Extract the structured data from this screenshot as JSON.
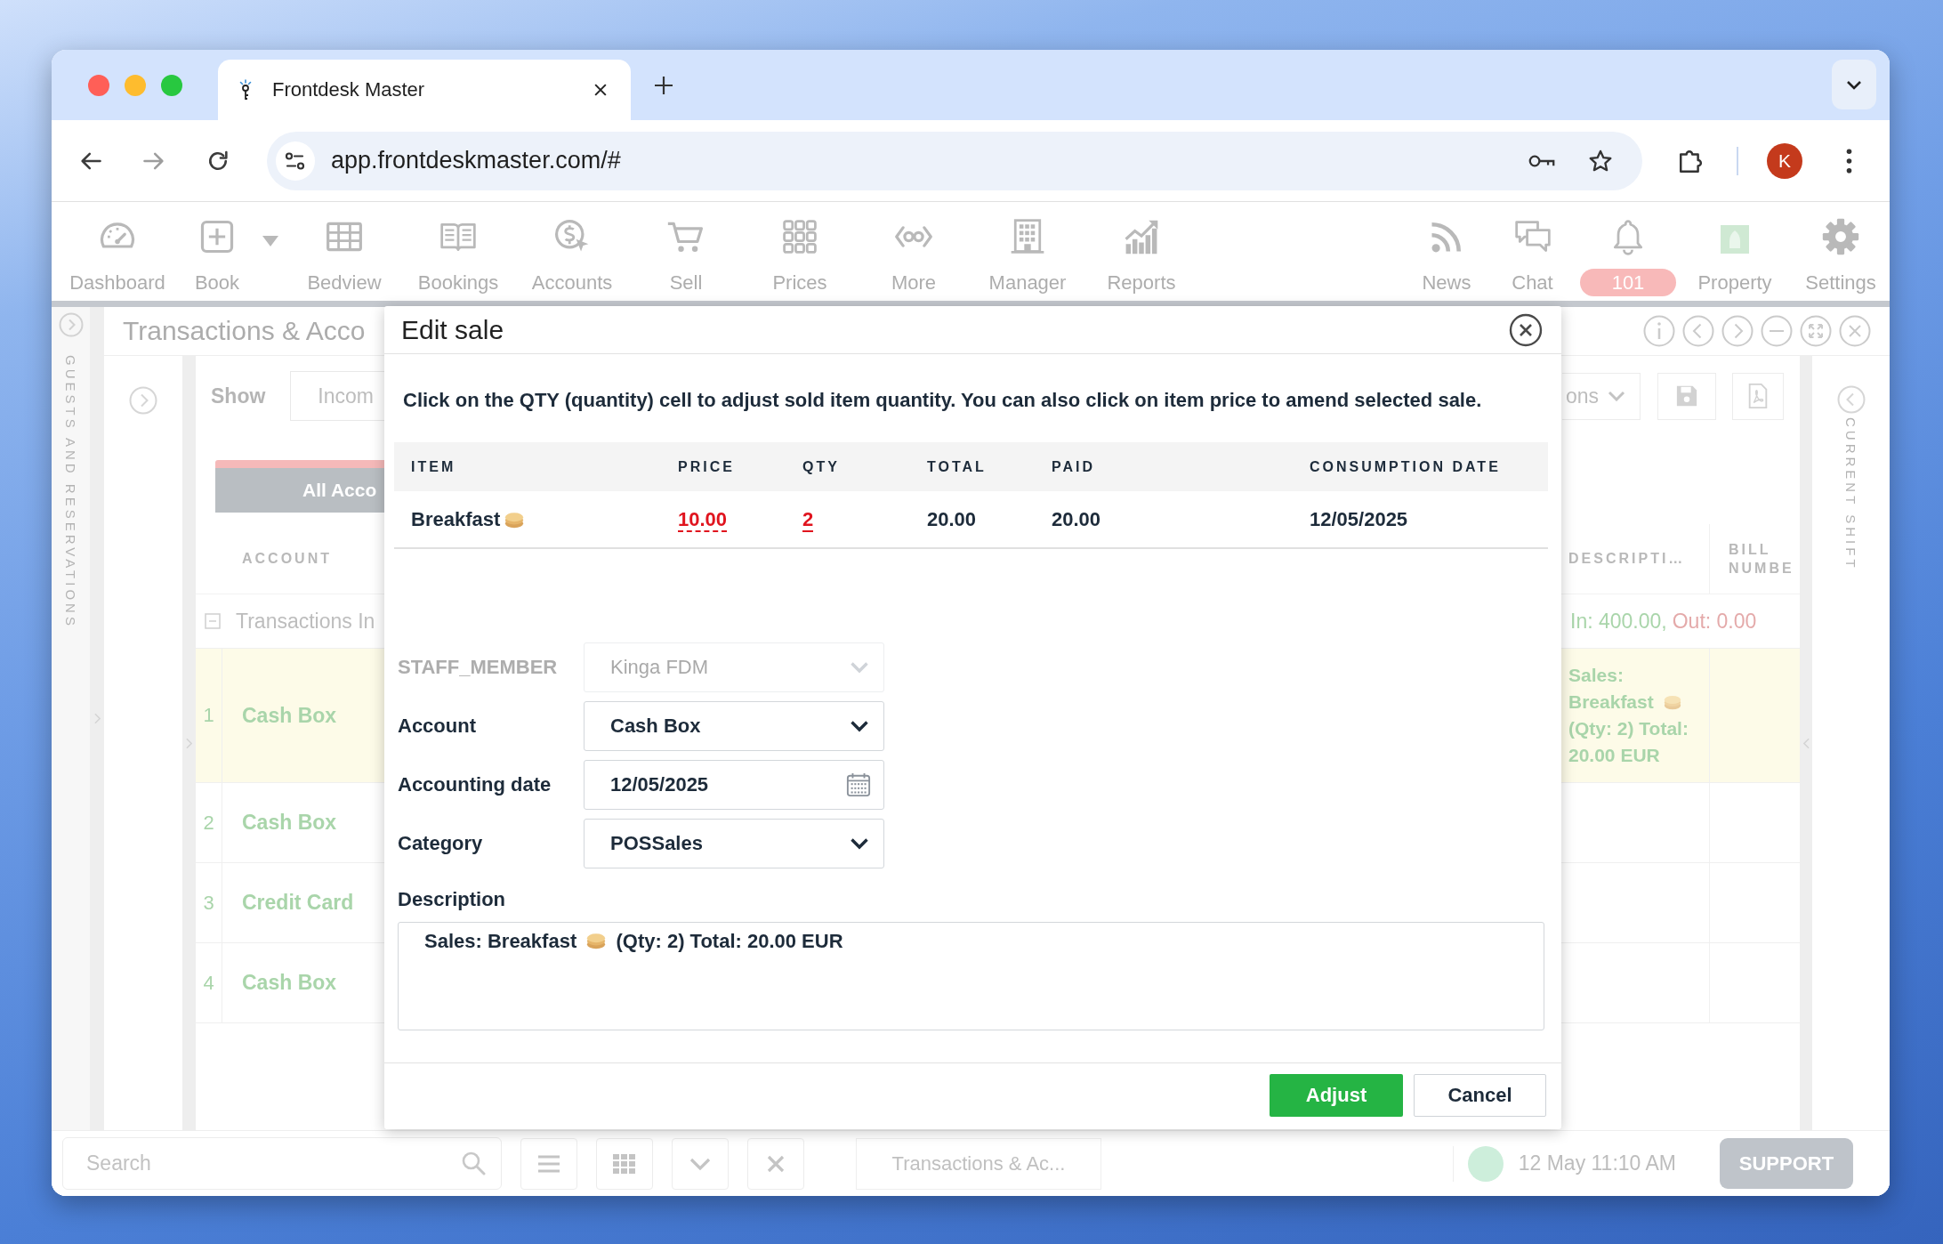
{
  "browser": {
    "tab_title": "Frontdesk Master",
    "address": "app.frontdeskmaster.com/#",
    "profile_initial": "K"
  },
  "toolbar": {
    "left": [
      {
        "label": "Dashboard",
        "kind": "plain"
      },
      {
        "label": "Book",
        "kind": "menu"
      },
      {
        "label": "Bedview",
        "kind": "plain"
      },
      {
        "label": "Bookings",
        "kind": "plain"
      },
      {
        "label": "Accounts",
        "kind": "plain"
      },
      {
        "label": "Sell",
        "kind": "plain"
      },
      {
        "label": "Prices",
        "kind": "plain"
      },
      {
        "label": "More",
        "kind": "plain"
      },
      {
        "label": "Manager",
        "kind": "plain"
      },
      {
        "label": "Reports",
        "kind": "plain"
      }
    ],
    "right": [
      {
        "label": "News",
        "kind": "plain"
      },
      {
        "label": "Chat",
        "kind": "plain"
      },
      {
        "badge": "101",
        "kind": "badge"
      },
      {
        "label": "Property",
        "kind": "plain"
      },
      {
        "label": "Settings",
        "kind": "plain"
      }
    ]
  },
  "side_panels": {
    "left": "GUESTS AND RESERVATIONS",
    "right": "CURRENT SHIFT"
  },
  "window": {
    "title": "Transactions & Acco",
    "filter": {
      "show_label": "Show",
      "type_value": "Incom",
      "accounts_button": "All Acco",
      "options_button": "ons"
    },
    "table": {
      "columns": [
        "ACCOUNT",
        "DESCRIPTI…",
        "BILL NUMBE"
      ],
      "group": {
        "label": "Transactions In",
        "expanded": true,
        "in_total": "In: 400.00,",
        "out_total": "Out: 0.00"
      },
      "rows": [
        {
          "number": "1",
          "account": "Cash Box",
          "selected": true,
          "description": [
            "Sales: Breakfast",
            "(Qty: 2) Total: 20.00 EUR"
          ]
        },
        {
          "number": "2",
          "account": "Cash Box",
          "selected": false
        },
        {
          "number": "3",
          "account": "Credit Card",
          "selected": false
        },
        {
          "number": "4",
          "account": "Cash Box",
          "selected": false
        }
      ]
    }
  },
  "dialog": {
    "title": "Edit sale",
    "instructions": "Click on the QTY (quantity) cell to adjust sold item quantity. You can also click on item price to amend selected sale.",
    "table": {
      "columns": [
        {
          "label": "ITEM",
          "editable": false
        },
        {
          "label": "PRICE",
          "editable": true
        },
        {
          "label": "QTY",
          "editable": true
        },
        {
          "label": "TOTAL",
          "editable": false
        },
        {
          "label": "PAID",
          "editable": false
        },
        {
          "label": "CONSUMPTION DATE",
          "editable": false
        }
      ],
      "rows": [
        {
          "cells": [
            "Breakfast",
            "10.00",
            "2",
            "20.00",
            "20.00",
            "12/05/2025"
          ]
        }
      ]
    },
    "fields": [
      {
        "label": "STAFF_MEMBER",
        "kind": "select",
        "value": "Kinga FDM",
        "disabled": true
      },
      {
        "label": "Account",
        "kind": "select",
        "value": "Cash Box",
        "disabled": false
      },
      {
        "label": "Accounting date",
        "kind": "date",
        "value": "12/05/2025",
        "disabled": false
      },
      {
        "label": "Category",
        "kind": "select",
        "value": "POSSales",
        "disabled": false
      }
    ],
    "description": {
      "label": "Description",
      "text": [
        "Sales: Breakfast",
        "(Qty: 2) Total: 20.00 EUR"
      ]
    },
    "buttons": [
      {
        "label": "Adjust",
        "kind": "primary"
      },
      {
        "label": "Cancel",
        "kind": "secondary"
      }
    ]
  },
  "status_bar": {
    "search_placeholder": "Search",
    "open_window": "Transactions & Ac...",
    "datetime": "12 May 11:10 AM",
    "support_button": "SUPPORT"
  }
}
